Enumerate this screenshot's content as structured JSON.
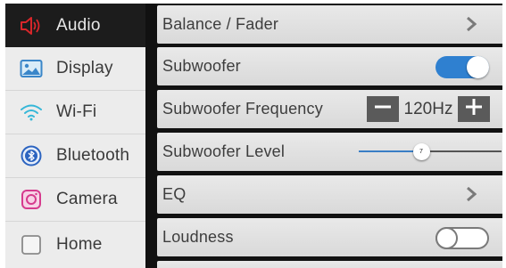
{
  "sidebar": {
    "items": [
      {
        "label": "Audio",
        "icon": "speaker-icon",
        "active": true
      },
      {
        "label": "Display",
        "icon": "image-icon",
        "active": false
      },
      {
        "label": "Wi-Fi",
        "icon": "wifi-icon",
        "active": false
      },
      {
        "label": "Bluetooth",
        "icon": "bluetooth-icon",
        "active": false
      },
      {
        "label": "Camera",
        "icon": "camera-icon",
        "active": false
      },
      {
        "label": "Home",
        "icon": "home-icon",
        "active": false
      }
    ]
  },
  "settings": {
    "balance_fader": {
      "label": "Balance / Fader"
    },
    "subwoofer": {
      "label": "Subwoofer",
      "enabled": true
    },
    "subwoofer_frequency": {
      "label": "Subwoofer Frequency",
      "value": "120Hz"
    },
    "subwoofer_level": {
      "label": "Subwoofer Level",
      "value": "7",
      "fraction": 0.5
    },
    "eq": {
      "label": "EQ"
    },
    "loudness": {
      "label": "Loudness",
      "enabled": false
    }
  },
  "colors": {
    "accent": "#2f80d0",
    "audio_icon_red": "#d8262a",
    "display_icon_blue": "#3a86c9",
    "wifi_icon_teal": "#35b7d8",
    "bluetooth_icon_blue": "#2c64c0",
    "camera_icon_pink": "#d63b8e"
  }
}
